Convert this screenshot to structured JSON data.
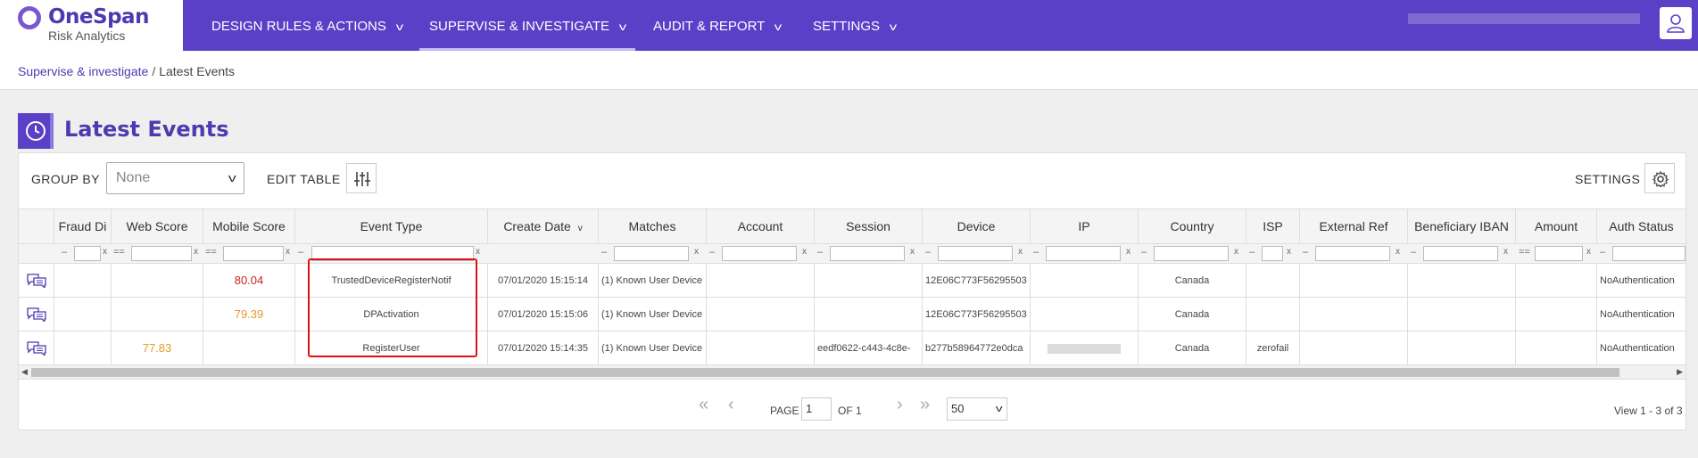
{
  "app": {
    "name": "OneSpan",
    "subtitle": "Risk Analytics"
  },
  "nav": [
    {
      "label": "DESIGN RULES & ACTIONS"
    },
    {
      "label": "SUPERVISE & INVESTIGATE",
      "active": true
    },
    {
      "label": "AUDIT & REPORT"
    },
    {
      "label": "SETTINGS"
    }
  ],
  "breadcrumb": {
    "parent": "Supervise & investigate",
    "separator": "/",
    "current": "Latest Events"
  },
  "page": {
    "title": "Latest Events",
    "icon": "clock-icon"
  },
  "toolbar": {
    "group_by_label": "GROUP BY",
    "group_by_value": "None",
    "edit_table_label": "EDIT TABLE",
    "settings_label": "SETTINGS"
  },
  "table": {
    "columns": [
      "Fraud Di",
      "Web Score",
      "Mobile Score",
      "Event Type",
      "Create Date",
      "Matches",
      "Account",
      "Session",
      "Device",
      "IP",
      "Country",
      "ISP",
      "External Ref",
      "Beneficiary IBAN",
      "Amount",
      "Auth Status"
    ],
    "sort": {
      "column": "Create Date",
      "direction": "desc"
    },
    "filter_ops": [
      "–",
      "==",
      "==",
      "–",
      "",
      "–",
      "–",
      "–",
      "–",
      "–",
      "–",
      "–",
      "–",
      "–",
      "==",
      "–"
    ],
    "rows": [
      [
        "",
        "",
        "80.04",
        "TrustedDeviceRegisterNotif",
        "07/01/2020 15:15:14",
        "(1) Known User Device",
        "",
        "",
        "12E06C773F56295503",
        "",
        "Canada",
        "",
        "",
        "",
        "",
        "NoAuthentication"
      ],
      [
        "",
        "",
        "79.39",
        "DPActivation",
        "07/01/2020 15:15:06",
        "(1) Known User Device",
        "",
        "",
        "12E06C773F56295503",
        "",
        "Canada",
        "",
        "",
        "",
        "",
        "NoAuthentication"
      ],
      [
        "",
        "77.83",
        "",
        "RegisterUser",
        "07/01/2020 15:14:35",
        "(1) Known User Device",
        "",
        "eedf0622-c443-4c8e-",
        "b277b58964772e0dca",
        "",
        "Canada",
        "zerofail",
        "",
        "",
        "",
        "NoAuthentication"
      ]
    ],
    "score_colors": {
      "high": "#cc2222",
      "medium": "#e59b2a"
    }
  },
  "pager": {
    "page_label": "PAGE",
    "page_value": "1",
    "of_label": "OF 1",
    "page_size": "50",
    "summary": "View 1 - 3 of 3"
  },
  "colors": {
    "brand": "#5a3fc7",
    "accent_text": "#4a3bb0",
    "highlight": "#e01010"
  }
}
